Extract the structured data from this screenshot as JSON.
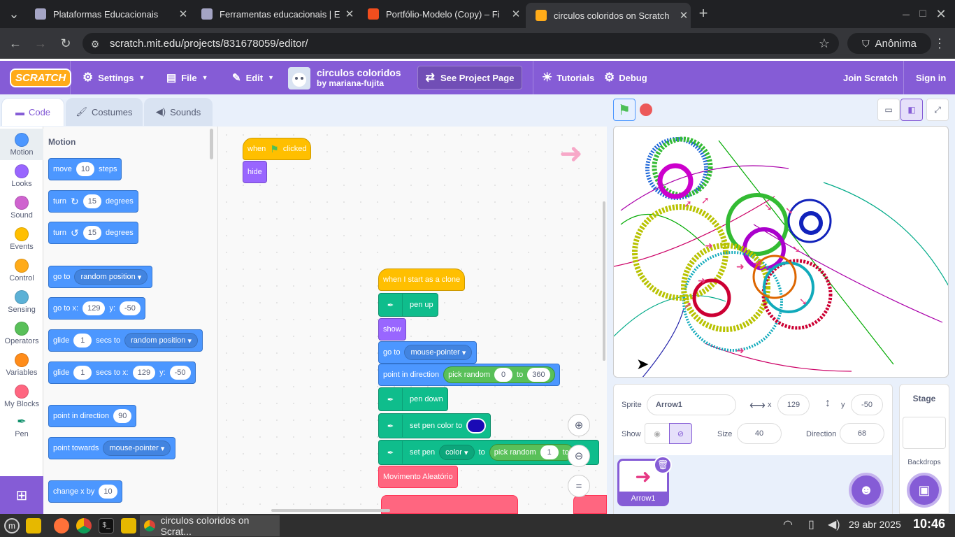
{
  "browser": {
    "tabs": [
      {
        "title": "Plataformas Educacionais",
        "favicon_color": "#a4a4c4"
      },
      {
        "title": "Ferramentas educacionais | E",
        "favicon_color": "#a4a4c4"
      },
      {
        "title": "Portfólio-Modelo (Copy) – Fi",
        "favicon_color": "#f24e1e"
      },
      {
        "title": "circulos coloridos on Scratch",
        "favicon_color": "#ffab19"
      }
    ],
    "url": "scratch.mit.edu/projects/831678059/editor/",
    "profile_label": "Anônima"
  },
  "menubar": {
    "logo": "SCRATCH",
    "settings": "Settings",
    "file": "File",
    "edit": "Edit",
    "project_title": "circulos coloridos",
    "project_author": "by mariana-fujita",
    "see_project_page": "See Project Page",
    "tutorials": "Tutorials",
    "debug": "Debug",
    "join": "Join Scratch",
    "signin": "Sign in"
  },
  "editor_tabs": {
    "code": "Code",
    "costumes": "Costumes",
    "sounds": "Sounds"
  },
  "categories": [
    {
      "label": "Motion",
      "color": "#4c97ff"
    },
    {
      "label": "Looks",
      "color": "#9966ff"
    },
    {
      "label": "Sound",
      "color": "#cf63cf"
    },
    {
      "label": "Events",
      "color": "#ffbf00"
    },
    {
      "label": "Control",
      "color": "#ffab19"
    },
    {
      "label": "Sensing",
      "color": "#5cb1d6"
    },
    {
      "label": "Operators",
      "color": "#59c059"
    },
    {
      "label": "Variables",
      "color": "#ff8c1a"
    },
    {
      "label": "My Blocks",
      "color": "#ff6680"
    },
    {
      "label": "Pen",
      "color": "#0fbd8c"
    }
  ],
  "palette": {
    "heading": "Motion",
    "move": {
      "a": "move",
      "v": "10",
      "b": "steps"
    },
    "turn_right": {
      "a": "turn",
      "v": "15",
      "b": "degrees"
    },
    "turn_left": {
      "a": "turn",
      "v": "15",
      "b": "degrees"
    },
    "goto": {
      "a": "go to",
      "dd": "random position"
    },
    "gotoxy": {
      "a": "go to x:",
      "x": "129",
      "b": "y:",
      "y": "-50"
    },
    "glide": {
      "a": "glide",
      "v": "1",
      "b": "secs to",
      "dd": "random position"
    },
    "glidexy": {
      "a": "glide",
      "v": "1",
      "b": "secs to x:",
      "x": "129",
      "c": "y:",
      "y": "-50"
    },
    "point_dir": {
      "a": "point in direction",
      "v": "90"
    },
    "point_towards": {
      "a": "point towards",
      "dd": "mouse-pointer"
    },
    "change_x": {
      "a": "change x by",
      "v": "10"
    }
  },
  "script": {
    "hat1": {
      "a": "when",
      "b": "clicked"
    },
    "hide": "hide",
    "hat2": "when I start as a clone",
    "penup": "pen up",
    "show": "show",
    "goto": {
      "a": "go to",
      "dd": "mouse-pointer"
    },
    "pointdir": {
      "a": "point in direction",
      "op": "pick random",
      "v1": "0",
      "b": "to",
      "v2": "360"
    },
    "pendown": "pen down",
    "setpencolor": {
      "a": "set pen color to",
      "color": "#1a0ab5"
    },
    "setpen": {
      "a": "set pen",
      "dd": "color",
      "b": "to",
      "op": "pick random",
      "v1": "1",
      "c": "to"
    },
    "custom": "Movimento Aleatório"
  },
  "sprite_info": {
    "sprite_label": "Sprite",
    "sprite_name": "Arrow1",
    "x_label": "x",
    "x": "129",
    "y_label": "y",
    "y": "-50",
    "show_label": "Show",
    "size_label": "Size",
    "size": "40",
    "direction_label": "Direction",
    "direction": "68",
    "thumb_name": "Arrow1"
  },
  "stage_pane": {
    "title": "Stage",
    "backdrops": "Backdrops"
  },
  "taskbar": {
    "window": "circulos coloridos on Scrat...",
    "date": "29 abr 2025",
    "time": "10:46"
  }
}
